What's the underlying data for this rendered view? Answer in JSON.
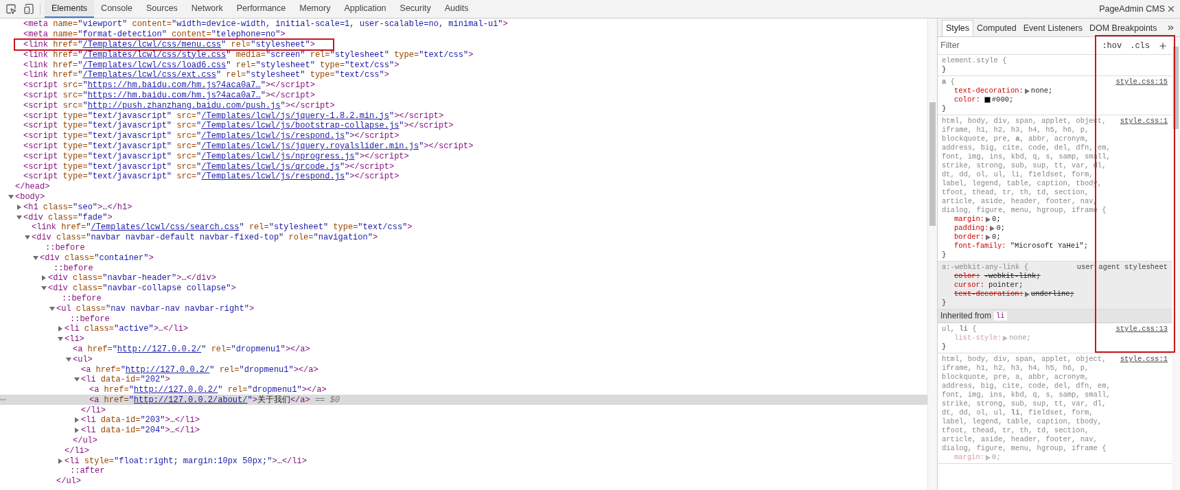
{
  "toolbar": {
    "tabs": [
      {
        "label": "Elements",
        "selected": true
      },
      {
        "label": "Console",
        "selected": false
      },
      {
        "label": "Sources",
        "selected": false
      },
      {
        "label": "Network",
        "selected": false
      },
      {
        "label": "Performance",
        "selected": false
      },
      {
        "label": "Memory",
        "selected": false
      },
      {
        "label": "Application",
        "selected": false
      },
      {
        "label": "Security",
        "selected": false
      },
      {
        "label": "Audits",
        "selected": false
      }
    ],
    "title": "PageAdmin CMS"
  },
  "elements": {
    "nodes": [
      {
        "close": "</head>",
        "children": [
          {
            "tag": "<meta",
            "attrs": [
              {
                "name": " name=",
                "value": "\"viewport\""
              },
              {
                "name": " content=",
                "value": "\"width=device-width, initial-scale=1, user-scalable=no, minimal-ui\""
              }
            ],
            "end": ">"
          },
          {
            "tag": "<meta",
            "attrs": [
              {
                "name": " name=",
                "value": "\"format-detection\""
              },
              {
                "name": " content=",
                "value": "\"telephone=no\""
              }
            ],
            "end": ">"
          },
          {
            "tag": "<link",
            "highlighted": true,
            "attrs": [
              {
                "name": " href=",
                "value": "\"/Templates/lcwl/css/menu.css\"",
                "link": true
              },
              {
                "name": " rel=",
                "value": "\"stylesheet\""
              }
            ],
            "end": ">"
          },
          {
            "tag": "<link",
            "attrs": [
              {
                "name": " href=",
                "value": "\"/Templates/lcwl/css/style.css\"",
                "link": true
              },
              {
                "name": " media=",
                "value": "\"screen\""
              },
              {
                "name": " rel=",
                "value": "\"stylesheet\""
              },
              {
                "name": " type=",
                "value": "\"text/css\""
              }
            ],
            "end": ">"
          },
          {
            "tag": "<link",
            "attrs": [
              {
                "name": " href=",
                "value": "\"/Templates/lcwl/css/load6.css\"",
                "link": true
              },
              {
                "name": " rel=",
                "value": "\"stylesheet\""
              },
              {
                "name": " type=",
                "value": "\"text/css\""
              }
            ],
            "end": ">"
          },
          {
            "tag": "<link",
            "attrs": [
              {
                "name": " href=",
                "value": "\"/Templates/lcwl/css/ext.css\"",
                "link": true
              },
              {
                "name": " rel=",
                "value": "\"stylesheet\""
              },
              {
                "name": " type=",
                "value": "\"text/css\""
              }
            ],
            "end": ">"
          },
          {
            "tag": "<script",
            "attrs": [
              {
                "name": " src=",
                "value": "\"https://hm.baidu.com/hm.js?4aca0a7…\"",
                "link": true
              }
            ],
            "end": ">",
            "close": "</script>"
          },
          {
            "tag": "<script",
            "attrs": [
              {
                "name": " src=",
                "value": "\"https://hm.baidu.com/hm.js?4aca0a7…\"",
                "link": true
              }
            ],
            "end": ">",
            "close": "</script>"
          },
          {
            "tag": "<script",
            "attrs": [
              {
                "name": " src=",
                "value": "\"http://push.zhanzhang.baidu.com/push.js\"",
                "link": true
              }
            ],
            "end": ">",
            "close": "</script>"
          },
          {
            "tag": "<script",
            "attrs": [
              {
                "name": " type=",
                "value": "\"text/javascript\""
              },
              {
                "name": " src=",
                "value": "\"/Templates/lcwl/js/jquery-1.8.2.min.js\"",
                "link": true
              }
            ],
            "end": ">",
            "close": "</script>"
          },
          {
            "tag": "<script",
            "attrs": [
              {
                "name": " type=",
                "value": "\"text/javascript\""
              },
              {
                "name": " src=",
                "value": "\"/Templates/lcwl/js/bootstrap-collapse.js\"",
                "link": true
              }
            ],
            "end": ">",
            "close": "</script>"
          },
          {
            "tag": "<script",
            "attrs": [
              {
                "name": " type=",
                "value": "\"text/javascript\""
              },
              {
                "name": " src=",
                "value": "\"/Templates/lcwl/js/respond.js\"",
                "link": true
              }
            ],
            "end": ">",
            "close": "</script>"
          },
          {
            "tag": "<script",
            "attrs": [
              {
                "name": " type=",
                "value": "\"text/javascript\""
              },
              {
                "name": " src=",
                "value": "\"/Templates/lcwl/js/jquery.royalslider.min.js\"",
                "link": true
              }
            ],
            "end": ">",
            "close": "</script>"
          },
          {
            "tag": "<script",
            "attrs": [
              {
                "name": " type=",
                "value": "\"text/javascript\""
              },
              {
                "name": " src=",
                "value": "\"/Templates/lcwl/js/nprogress.js\"",
                "link": true
              }
            ],
            "end": ">",
            "close": "</script>"
          },
          {
            "tag": "<script",
            "attrs": [
              {
                "name": " type=",
                "value": "\"text/javascript\""
              },
              {
                "name": " src=",
                "value": "\"/Templates/lcwl/js/qrcode.js\"",
                "link": true
              }
            ],
            "end": ">",
            "close": "</script>"
          },
          {
            "tag": "<script",
            "attrs": [
              {
                "name": " type=",
                "value": "\"text/javascript\""
              },
              {
                "name": " src=",
                "value": "\"/Templates/lcwl/js/respond.js\"",
                "link": true
              }
            ],
            "end": ">",
            "close": "</script>"
          }
        ]
      },
      {
        "tag": "<body",
        "end": ">",
        "expanded": true,
        "children": [
          {
            "tag": "<h1",
            "attrs": [
              {
                "name": " class=",
                "value": "\"seo\""
              }
            ],
            "end": ">",
            "expanded": false,
            "inner": "…",
            "close": "</h1>"
          },
          {
            "tag": "<div",
            "attrs": [
              {
                "name": " class=",
                "value": "\"fade\""
              }
            ],
            "end": ">",
            "expanded": true,
            "children": [
              {
                "tag": "<link",
                "attrs": [
                  {
                    "name": " href=",
                    "value": "\"/Templates/lcwl/css/search.css\"",
                    "link": true
                  },
                  {
                    "name": " rel=",
                    "value": "\"stylesheet\""
                  },
                  {
                    "name": " type=",
                    "value": "\"text/css\""
                  }
                ],
                "end": ">"
              },
              {
                "tag": "<div",
                "attrs": [
                  {
                    "name": " class=",
                    "value": "\"navbar navbar-default navbar-fixed-top\""
                  },
                  {
                    "name": " role=",
                    "value": "\"navigation\""
                  }
                ],
                "end": ">",
                "expanded": true,
                "children": [
                  {
                    "pseudo": "::before"
                  },
                  {
                    "tag": "<div",
                    "attrs": [
                      {
                        "name": " class=",
                        "value": "\"container\""
                      }
                    ],
                    "end": ">",
                    "expanded": true,
                    "children": [
                      {
                        "pseudo": "::before"
                      },
                      {
                        "tag": "<div",
                        "attrs": [
                          {
                            "name": " class=",
                            "value": "\"navbar-header\""
                          }
                        ],
                        "end": ">",
                        "expanded": false,
                        "inner": "…",
                        "close": "</div>"
                      },
                      {
                        "tag": "<div",
                        "attrs": [
                          {
                            "name": " class=",
                            "value": "\"navbar-collapse collapse\""
                          }
                        ],
                        "end": ">",
                        "expanded": true,
                        "children": [
                          {
                            "pseudo": "::before"
                          },
                          {
                            "tag": "<ul",
                            "attrs": [
                              {
                                "name": " class=",
                                "value": "\"nav navbar-nav navbar-right\""
                              }
                            ],
                            "end": ">",
                            "expanded": true,
                            "close": "</ul>",
                            "children": [
                              {
                                "pseudo": "::before"
                              },
                              {
                                "tag": "<li",
                                "attrs": [
                                  {
                                    "name": " class=",
                                    "value": "\"active\""
                                  }
                                ],
                                "end": ">",
                                "expanded": false,
                                "inner": "…",
                                "close": "</li>"
                              },
                              {
                                "tag": "<li",
                                "end": ">",
                                "expanded": true,
                                "close": "</li>",
                                "children": [
                                  {
                                    "tag": "<a",
                                    "attrs": [
                                      {
                                        "name": " href=",
                                        "value": "\"http://127.0.0.2/\"",
                                        "link": true
                                      },
                                      {
                                        "name": " rel=",
                                        "value": "\"dropmenu1\""
                                      }
                                    ],
                                    "end": ">",
                                    "close": "</a>"
                                  },
                                  {
                                    "tag": "<ul",
                                    "end": ">",
                                    "expanded": true,
                                    "close": "</ul>",
                                    "children": [
                                      {
                                        "tag": "<a",
                                        "attrs": [
                                          {
                                            "name": " href=",
                                            "value": "\"http://127.0.0.2/\"",
                                            "link": true
                                          },
                                          {
                                            "name": " rel=",
                                            "value": "\"dropmenu1\""
                                          }
                                        ],
                                        "end": ">",
                                        "close": "</a>"
                                      },
                                      {
                                        "tag": "<li",
                                        "attrs": [
                                          {
                                            "name": " data-id=",
                                            "value": "\"202\""
                                          }
                                        ],
                                        "end": ">",
                                        "expanded": true,
                                        "close": "</li>",
                                        "children": [
                                          {
                                            "tag": "<a",
                                            "attrs": [
                                              {
                                                "name": " href=",
                                                "value": "\"http://127.0.0.2/\"",
                                                "link": true
                                              },
                                              {
                                                "name": " rel=",
                                                "value": "\"dropmenu1\""
                                              }
                                            ],
                                            "end": ">",
                                            "close": "</a>"
                                          },
                                          {
                                            "tag": "<a",
                                            "selected": true,
                                            "attrs": [
                                              {
                                                "name": " href=",
                                                "value": "\"http://127.0.0.2/about/\"",
                                                "link": true
                                              }
                                            ],
                                            "end": ">",
                                            "inner": "关于我们",
                                            "close": "</a>",
                                            "suffix": " == $0"
                                          }
                                        ]
                                      },
                                      {
                                        "tag": "<li",
                                        "attrs": [
                                          {
                                            "name": " data-id=",
                                            "value": "\"203\""
                                          }
                                        ],
                                        "end": ">",
                                        "expanded": false,
                                        "inner": "…",
                                        "close": "</li>"
                                      },
                                      {
                                        "tag": "<li",
                                        "attrs": [
                                          {
                                            "name": " data-id=",
                                            "value": "\"204\""
                                          }
                                        ],
                                        "end": ">",
                                        "expanded": false,
                                        "inner": "…",
                                        "close": "</li>"
                                      }
                                    ]
                                  }
                                ]
                              },
                              {
                                "tag": "<li",
                                "attrs": [
                                  {
                                    "name": " style=",
                                    "value": "\"float:right; margin:10px 50px;\""
                                  }
                                ],
                                "end": ">",
                                "expanded": false,
                                "inner": "…",
                                "close": "</li>"
                              },
                              {
                                "pseudo": "::after"
                              }
                            ]
                          }
                        ]
                      }
                    ]
                  }
                ]
              }
            ]
          }
        ]
      }
    ]
  },
  "styles_panel": {
    "tabs": [
      {
        "label": "Styles",
        "selected": true
      },
      {
        "label": "Computed",
        "selected": false
      },
      {
        "label": "Event Listeners",
        "selected": false
      },
      {
        "label": "DOM Breakpoints",
        "selected": false
      }
    ],
    "filter": {
      "placeholder": "Filter"
    },
    "buttons": [
      ":hov",
      ".cls"
    ],
    "annotation": true,
    "rules": [
      {
        "kind": "rule",
        "selector": "element.style {",
        "close": "}"
      },
      {
        "kind": "rule",
        "selector": "**a** {",
        "source": "style.css:15",
        "properties": [
          {
            "name": "text-decoration:",
            "expandable": true,
            "value": "none;"
          },
          {
            "name": "color:",
            "color": "#000000",
            "value": "#000;"
          }
        ],
        "close": "}"
      },
      {
        "kind": "rule",
        "selector": "html, body, div, span, applet, object, iframe, h1, h2, h3, h4, h5, h6, p, blockquote, pre, **a**, abbr, acronym, address, big, cite, code, del, dfn, em, font, img, ins, kbd, q, s, samp, small, strike, strong, sub, sup, tt, var, dl, dt, dd, ol, ul, li, fieldset, form, label, legend, table, caption, tbody, tfoot, thead, tr, th, td, section, article, aside, header, footer, nav, dialog, figure, menu, hgroup, iframe {",
        "source": "style.css:1",
        "properties": [
          {
            "name": "margin:",
            "expandable": true,
            "value": "0;"
          },
          {
            "name": "padding:",
            "expandable": true,
            "value": "0;"
          },
          {
            "name": "border:",
            "expandable": true,
            "value": "0;"
          },
          {
            "name": "font-family:",
            "value": "\"Microsoft YaHei\";"
          }
        ],
        "close": "}"
      },
      {
        "kind": "rule",
        "user_agent": true,
        "selector": "a:-webkit-any-link {",
        "source": "user agent stylesheet",
        "properties": [
          {
            "name": "color:",
            "value": "-webkit-link;",
            "struck": true
          },
          {
            "name": "cursor:",
            "value": "pointer;"
          },
          {
            "name": "text-decoration:",
            "expandable": true,
            "value": "underline;",
            "struck": true
          }
        ],
        "close": "}"
      },
      {
        "kind": "inherited",
        "label": "Inherited from",
        "element": "li"
      },
      {
        "kind": "rule",
        "selector": "ul, **li** {",
        "source": "style.css:13",
        "properties": [
          {
            "name": "list-style:",
            "expandable": true,
            "value": "none;",
            "inactive": true
          }
        ],
        "close": "}"
      },
      {
        "kind": "rule",
        "selector": "html, body, div, span, applet, object, iframe, h1, h2, h3, h4, h5, h6, p, blockquote, pre, a, abbr, acronym, address, big, cite, code, del, dfn, em, font, img, ins, kbd, q, s, samp, small, strike, strong, sub, sup, tt, var, dl, dt, dd, ol, ul, **li**, fieldset, form, label, legend, table, caption, tbody, tfoot, thead, tr, th, td, section, article, aside, header, footer, nav, dialog, figure, menu, hgroup, iframe {",
        "source": "style.css:1",
        "properties": [
          {
            "name": "margin:",
            "expandable": true,
            "value": "0;",
            "inactive": true
          }
        ]
      }
    ]
  }
}
